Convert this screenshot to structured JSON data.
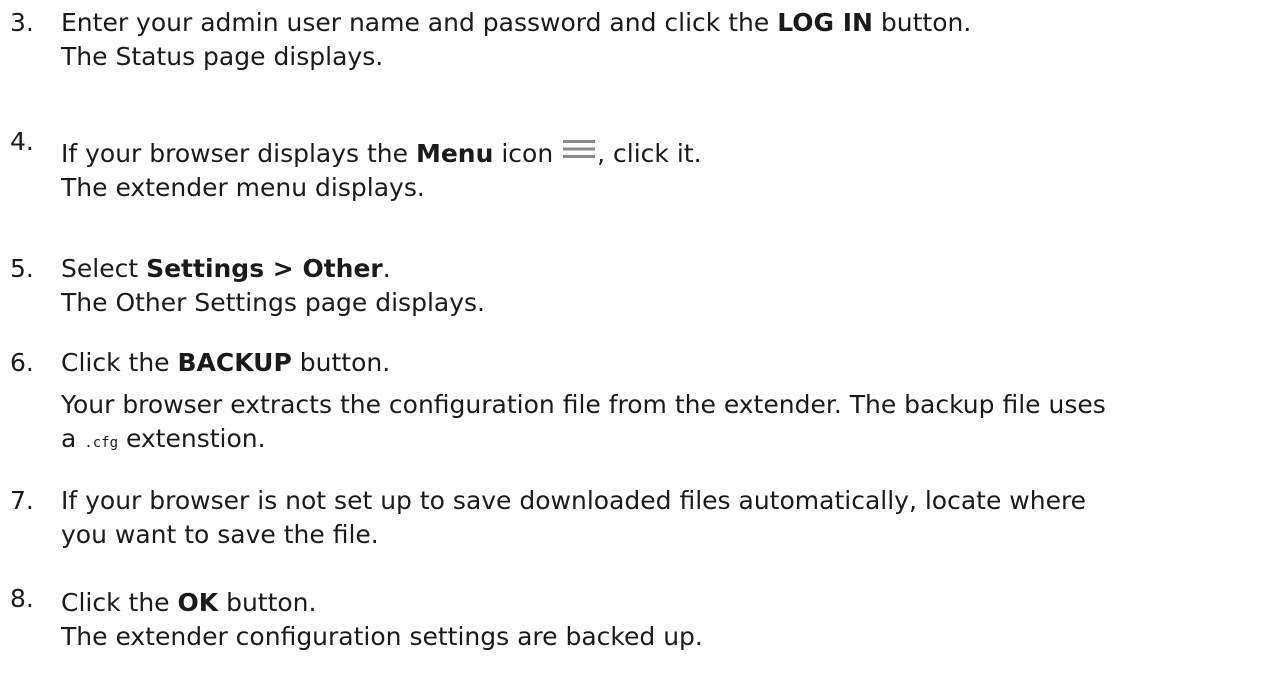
{
  "steps": [
    {
      "number": "3.",
      "line1_a": "Enter your admin user name and password and click the ",
      "line1_bold": "LOG IN",
      "line1_b": " button.",
      "line2": "The Status page displays."
    },
    {
      "number": "4.",
      "line1_a": "If your browser displays the ",
      "line1_bold": "Menu",
      "line1_b": " icon ",
      "line1_c": ", click it.",
      "icon": "menu-icon",
      "line2": "The extender menu displays."
    },
    {
      "number": "5.",
      "line1_a": "Select ",
      "line1_bold": "Settings > Other",
      "line1_b": ".",
      "line2": "The Other Settings page displays."
    },
    {
      "number": "6.",
      "line1_a": "Click the ",
      "line1_bold": "BACKUP",
      "line1_b": " button.",
      "line2_a": "Your browser extracts the configuration file from the extender. The backup file uses",
      "line3_a": "a ",
      "line3_code": ".cfg",
      "line3_b": " extenstion."
    },
    {
      "number": "7.",
      "line1": "If your browser is not set up to save downloaded files automatically, locate where",
      "line2": "you want to save the file."
    },
    {
      "number": "8.",
      "line1_a": "Click the ",
      "line1_bold": "OK",
      "line1_b": " button.",
      "line2": "The extender configuration settings are backed up."
    }
  ],
  "colors": {
    "text": "#1a1a1a",
    "icon": "#8a8a8a"
  }
}
